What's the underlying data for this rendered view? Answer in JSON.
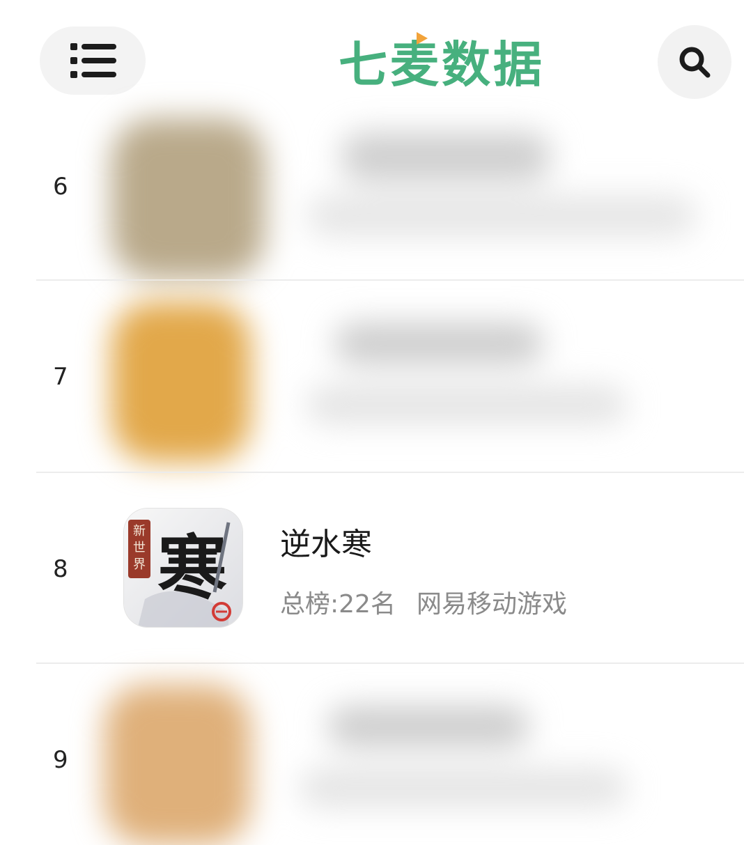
{
  "header": {
    "menu_icon": "list-menu-icon",
    "logo_text": "七麦数据",
    "search_icon": "search-icon",
    "brand_color": "#47b07e"
  },
  "rows": [
    {
      "rank": "6",
      "blurred": true
    },
    {
      "rank": "7",
      "blurred": true
    },
    {
      "rank": "8",
      "blurred": false,
      "app_name": "逆水寒",
      "overall_rank": "总榜:22名",
      "publisher": "网易移动游戏",
      "icon": "nishuihan-app-icon",
      "icon_badge_text": "新世界",
      "icon_glyph": "寒"
    },
    {
      "rank": "9",
      "blurred": true
    }
  ]
}
